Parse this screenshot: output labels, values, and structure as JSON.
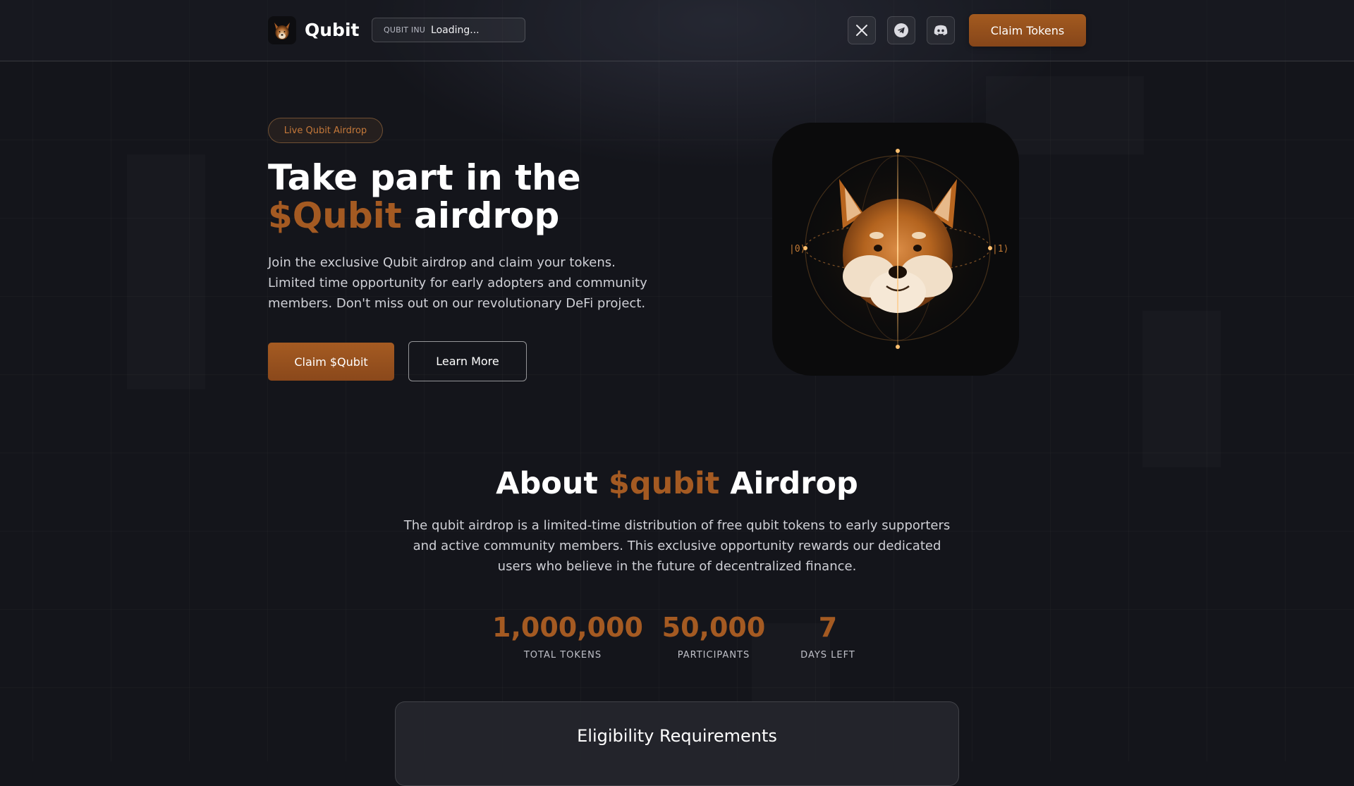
{
  "header": {
    "brand": "Qubit",
    "ticker": {
      "symbol": "QUBIT INU",
      "value": "Loading..."
    },
    "social": [
      {
        "name": "x-icon"
      },
      {
        "name": "telegram-icon"
      },
      {
        "name": "discord-icon"
      }
    ],
    "claim_label": "Claim Tokens"
  },
  "hero": {
    "badge": "Live Qubit Airdrop",
    "title_line1": "Take part in the",
    "title_accent": "$Qubit",
    "title_rest": " airdrop",
    "description": "Join the exclusive Qubit airdrop and claim your tokens. Limited time opportunity for early adopters and community members. Don't miss out on our revolutionary DeFi project.",
    "primary_label": "Claim $Qubit",
    "secondary_label": "Learn More",
    "card_left_label": "|0⟩",
    "card_right_label": "|1⟩"
  },
  "about": {
    "title_start": "About ",
    "title_accent": "$qubit",
    "title_end": " Airdrop",
    "description": "The qubit airdrop is a limited-time distribution of free qubit tokens to early supporters and active community members. This exclusive opportunity rewards our dedicated users who believe in the future of decentralized finance.",
    "stats": [
      {
        "value": "1,000,000",
        "label": "TOTAL TOKENS"
      },
      {
        "value": "50,000",
        "label": "PARTICIPANTS"
      },
      {
        "value": "7",
        "label": "DAYS LEFT"
      }
    ]
  },
  "eligibility": {
    "title": "Eligibility Requirements"
  },
  "colors": {
    "accent": "#a45a22",
    "background": "#14151b"
  }
}
